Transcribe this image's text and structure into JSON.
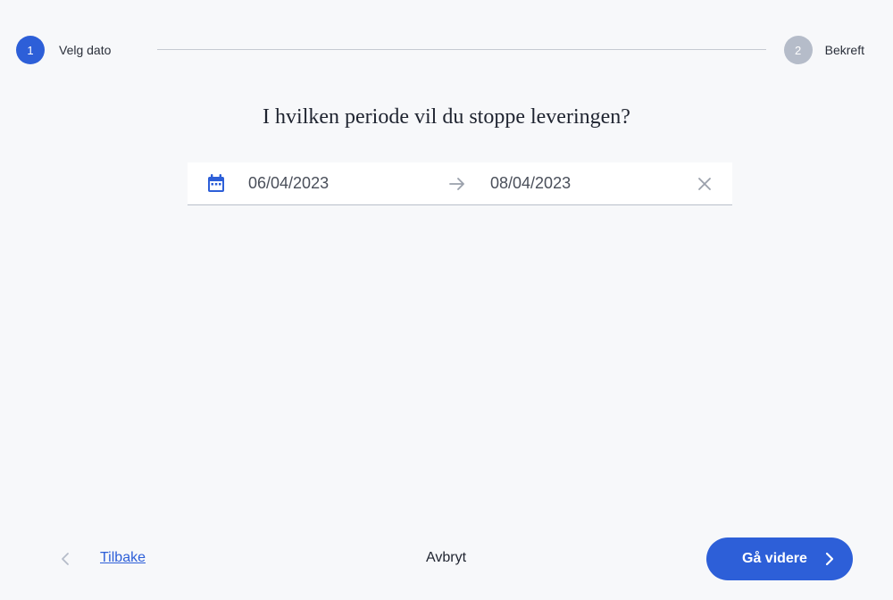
{
  "stepper": {
    "steps": [
      {
        "number": "1",
        "label": "Velg dato",
        "state": "active"
      },
      {
        "number": "2",
        "label": "Bekreft",
        "state": "inactive"
      }
    ]
  },
  "heading": "I hvilken periode vil du stoppe leveringen?",
  "date_range": {
    "start": "06/04/2023",
    "end": "08/04/2023",
    "icons": {
      "calendar": "calendar-icon",
      "arrow": "arrow-right-icon",
      "clear": "close-icon"
    }
  },
  "footer": {
    "back_label": "Tilbake",
    "cancel_label": "Avbryt",
    "next_label": "Gå videre"
  },
  "colors": {
    "accent": "#2d5fd8",
    "inactive_step": "#b5bcc9",
    "background": "#f7f8fa"
  }
}
